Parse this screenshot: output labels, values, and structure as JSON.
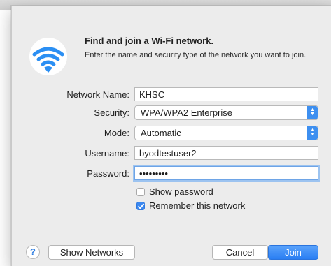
{
  "dialog": {
    "title": "Find and join a Wi-Fi network.",
    "subtitle": "Enter the name and security type of the network you want to join."
  },
  "form": {
    "network_name": {
      "label": "Network Name:",
      "value": "KHSC"
    },
    "security": {
      "label": "Security:",
      "value": "WPA/WPA2 Enterprise"
    },
    "mode": {
      "label": "Mode:",
      "value": "Automatic"
    },
    "username": {
      "label": "Username:",
      "value": "byodtestuser2"
    },
    "password": {
      "label": "Password:",
      "value": "•••••••••"
    },
    "show_password": {
      "label": "Show password",
      "checked": false
    },
    "remember_network": {
      "label": "Remember this network",
      "checked": true
    }
  },
  "buttons": {
    "help": "?",
    "show_networks": "Show Networks",
    "cancel": "Cancel",
    "join": "Join"
  },
  "icons": {
    "wifi": "wifi-icon",
    "select_arrows": "updown-chevron-icon",
    "check": "checkmark-icon"
  },
  "colors": {
    "accent": "#3b88f0",
    "wifi_icon": "#2b8ff3",
    "dialog_bg": "#ececec"
  }
}
